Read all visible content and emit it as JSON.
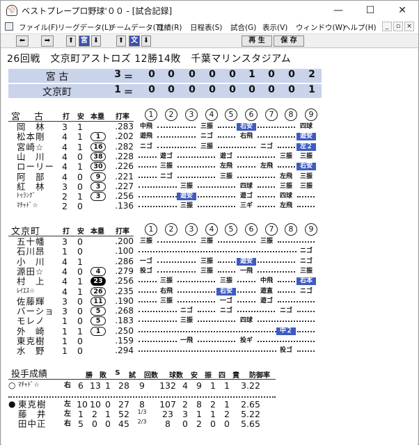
{
  "window": {
    "title": "ベストプレープロ野球'００ - [試合記録]",
    "controls": {
      "minimize": "—",
      "maximize": "☐",
      "close": "✕"
    }
  },
  "menu": {
    "items": [
      "ファイル(F)",
      "リーグデータ(L)",
      "チームデータ(T)",
      "成績(R)",
      "日程表(S)",
      "試合(G)",
      "表示(V)",
      "ウィンドウ(W)",
      "ヘルプ(H)"
    ],
    "mdi": [
      "_",
      "▫",
      "×"
    ]
  },
  "toolbar": {
    "prev": "⬅",
    "next": "➡",
    "up": "⬆",
    "miyako": "宮",
    "down": "⬇",
    "up2": "⬆",
    "bunkyo": "文",
    "down2": "⬇",
    "replay": "再 生",
    "save": "保 存"
  },
  "game": {
    "info": "26回戦　文京町アストロズ 12勝14敗　千葉マリンスタジアム"
  },
  "scoreboard": [
    {
      "team": "宮 古",
      "total": "3",
      "eq": "＝",
      "innings": [
        "0",
        "0",
        "0",
        "0",
        "0",
        "1",
        "0",
        "0",
        "2"
      ]
    },
    {
      "team": "文京町",
      "total": "1",
      "eq": "＝",
      "innings": [
        "0",
        "0",
        "0",
        "0",
        "0",
        "0",
        "0",
        "0",
        "1"
      ]
    }
  ],
  "batting_headers": {
    "at_bats": "打",
    "hits": "安",
    "hr": "本塁",
    "avg": "打率",
    "innings": [
      "1",
      "2",
      "3",
      "4",
      "5",
      "6",
      "7",
      "8",
      "9"
    ]
  },
  "miyako": {
    "team": "宮 古",
    "players": [
      {
        "name": "岡　林",
        "ab": "3",
        "h": "1",
        "hr": "",
        "avg": ".283",
        "results": [
          [
            "1",
            "中飛",
            0
          ],
          [
            "4",
            "三振",
            0
          ],
          [
            "6",
            "右安",
            1
          ],
          [
            "9",
            "四球",
            0
          ]
        ]
      },
      {
        "name": "松本剛",
        "ab": "4",
        "h": "1",
        "hr": "1",
        "avg": ".202",
        "results": [
          [
            "1",
            "遊飛",
            0
          ],
          [
            "4",
            "ニゴ",
            0
          ],
          [
            "6",
            "右飛",
            0
          ],
          [
            "9",
            "遊安",
            1
          ]
        ]
      },
      {
        "name": "宮崎☆",
        "ab": "4",
        "h": "1",
        "hr": "16",
        "avg": ".282",
        "results": [
          [
            "1",
            "ニゴ",
            0
          ],
          [
            "4",
            "三振",
            0
          ],
          [
            "7",
            "ニゴ",
            0
          ],
          [
            "9",
            "左２",
            1
          ]
        ]
      },
      {
        "name": "山　川",
        "ab": "4",
        "h": "0",
        "hr": "38",
        "avg": ".228",
        "results": [
          [
            "2",
            "遊ゴ",
            0
          ],
          [
            "5",
            "遊ゴ",
            0
          ],
          [
            "8",
            "三振",
            0
          ],
          [
            "9",
            "三振",
            0
          ]
        ]
      },
      {
        "name": "ローリー",
        "ab": "4",
        "h": "1",
        "hr": "30",
        "avg": ".226",
        "results": [
          [
            "2",
            "三振",
            0
          ],
          [
            "5",
            "左飛",
            0
          ],
          [
            "7",
            "左飛",
            0
          ],
          [
            "9",
            "右安",
            1
          ]
        ]
      },
      {
        "name": "阿　部",
        "ab": "4",
        "h": "0",
        "hr": "9",
        "avg": ".221",
        "results": [
          [
            "2",
            "ニゴ",
            0
          ],
          [
            "5",
            "三振",
            0
          ],
          [
            "8",
            "左飛",
            0
          ],
          [
            "9",
            "三振",
            0
          ]
        ]
      },
      {
        "name": "紅　林",
        "ab": "3",
        "h": "0",
        "hr": "3",
        "avg": ".227",
        "results": [
          [
            "3",
            "三振",
            0
          ],
          [
            "6",
            "四球",
            0
          ],
          [
            "8",
            "三振",
            0
          ],
          [
            "9",
            "三振",
            0
          ]
        ]
      },
      {
        "name": "ﾄｩﾗﾝｸﾞ",
        "ab": "2",
        "h": "1",
        "hr": "3",
        "avg": ".256",
        "results": [
          [
            "3",
            "遊安",
            1
          ],
          [
            "6",
            "遊ゴ",
            0
          ],
          [
            "8",
            "四球",
            0
          ]
        ]
      },
      {
        "name": "ﾏﾁｬﾄﾞ☆",
        "ab": "2",
        "h": "0",
        "hr": "",
        "avg": ".136",
        "results": [
          [
            "3",
            "三振",
            0
          ],
          [
            "6",
            "三ギ",
            0
          ],
          [
            "8",
            "左飛",
            0
          ]
        ]
      }
    ]
  },
  "bunkyo": {
    "team": "文京町",
    "players": [
      {
        "name": "五十幡",
        "ab": "3",
        "h": "0",
        "hr": "",
        "avg": ".200",
        "results": [
          [
            "1",
            "三振",
            0
          ],
          [
            "4",
            "三振",
            0
          ],
          [
            "7",
            "三振",
            0
          ]
        ]
      },
      {
        "name": "石川昂",
        "ab": "1",
        "h": "0",
        "hr": "",
        "avg": ".100",
        "results": [
          [
            "9",
            "ニゴ",
            0
          ]
        ]
      },
      {
        "name": "小　川",
        "ab": "4",
        "h": "1",
        "hr": "",
        "avg": ".286",
        "results": [
          [
            "1",
            "一ゴ",
            0
          ],
          [
            "4",
            "三振",
            0
          ],
          [
            "6",
            "遊安",
            1
          ],
          [
            "9",
            "ニゴ",
            0
          ]
        ]
      },
      {
        "name": "源田☆",
        "ab": "4",
        "h": "0",
        "hr": "4",
        "avg": ".279",
        "results": [
          [
            "1",
            "投ゴ",
            0
          ],
          [
            "4",
            "三振",
            0
          ],
          [
            "6",
            "一飛",
            0
          ],
          [
            "9",
            "三振",
            0
          ]
        ]
      },
      {
        "name": "村　上",
        "ab": "4",
        "h": "1",
        "hr": "23",
        "avg": ".256",
        "black": true,
        "results": [
          [
            "2",
            "三振",
            0
          ],
          [
            "5",
            "三振",
            0
          ],
          [
            "7",
            "中飛",
            0
          ],
          [
            "9",
            "右本",
            1
          ]
        ]
      },
      {
        "name": "ﾚｲｴｽ☆",
        "ab": "4",
        "h": "1",
        "hr": "26",
        "avg": ".235",
        "results": [
          [
            "2",
            "右飛",
            0
          ],
          [
            "5",
            "右安",
            1
          ],
          [
            "7",
            "遊直",
            0
          ],
          [
            "9",
            "ニゴ",
            0
          ]
        ]
      },
      {
        "name": "佐藤輝",
        "ab": "3",
        "h": "0",
        "hr": "11",
        "avg": ".190",
        "results": [
          [
            "2",
            "三振",
            0
          ],
          [
            "5",
            "一ゴ",
            0
          ],
          [
            "7",
            "遊ゴ",
            0
          ]
        ]
      },
      {
        "name": "バーショ",
        "ab": "3",
        "h": "0",
        "hr": "5",
        "avg": ".268",
        "results": [
          [
            "3",
            "ニゴ",
            0
          ],
          [
            "5",
            "ニゴ",
            0
          ],
          [
            "8",
            "ニゴ",
            0
          ]
        ]
      },
      {
        "name": "モレノ",
        "ab": "1",
        "h": "0",
        "hr": "5",
        "avg": ".183",
        "results": [
          [
            "3",
            "三振",
            0
          ],
          [
            "6",
            "四球",
            0
          ]
        ]
      },
      {
        "name": "外　崎",
        "ab": "1",
        "h": "1",
        "hr": "1",
        "avg": ".250",
        "results": [
          [
            "8",
            "中２",
            1
          ]
        ]
      },
      {
        "name": "東克樹",
        "ab": "1",
        "h": "0",
        "hr": "",
        "avg": ".159",
        "results": [
          [
            "3",
            "一飛",
            0
          ],
          [
            "6",
            "投ギ",
            0
          ]
        ]
      },
      {
        "name": "水　野",
        "ab": "1",
        "h": "0",
        "hr": "",
        "avg": ".294",
        "results": [
          [
            "8",
            "投ゴ",
            0
          ]
        ]
      }
    ]
  },
  "pitching": {
    "title": "投手成績",
    "headers": [
      "勝",
      "敗",
      "S",
      "試",
      "回数",
      "球数",
      "安",
      "振",
      "四",
      "責",
      "防御率"
    ],
    "pitchers": [
      {
        "mark": "○",
        "name": "ﾏﾁｬﾄﾞ☆",
        "hand": "右",
        "stats": [
          "6",
          "13",
          "1",
          "28",
          "9",
          "132",
          "4",
          "9",
          "1",
          "1",
          "3.22"
        ]
      },
      {
        "mark": "●",
        "name": "東克樹",
        "hand": "左",
        "stats": [
          "10",
          "10",
          "0",
          "27",
          "8",
          "107",
          "2",
          "8",
          "2",
          "1",
          "2.65"
        ]
      },
      {
        "mark": "",
        "name": "藤　井",
        "hand": "左",
        "stats": [
          "1",
          "2",
          "1",
          "52",
          "1/3",
          "23",
          "3",
          "1",
          "1",
          "2",
          "5.22"
        ]
      },
      {
        "mark": "",
        "name": "田中正",
        "hand": "右",
        "stats": [
          "5",
          "0",
          "0",
          "45",
          "2/3",
          "8",
          "0",
          "2",
          "0",
          "0",
          "5.65"
        ]
      }
    ]
  }
}
